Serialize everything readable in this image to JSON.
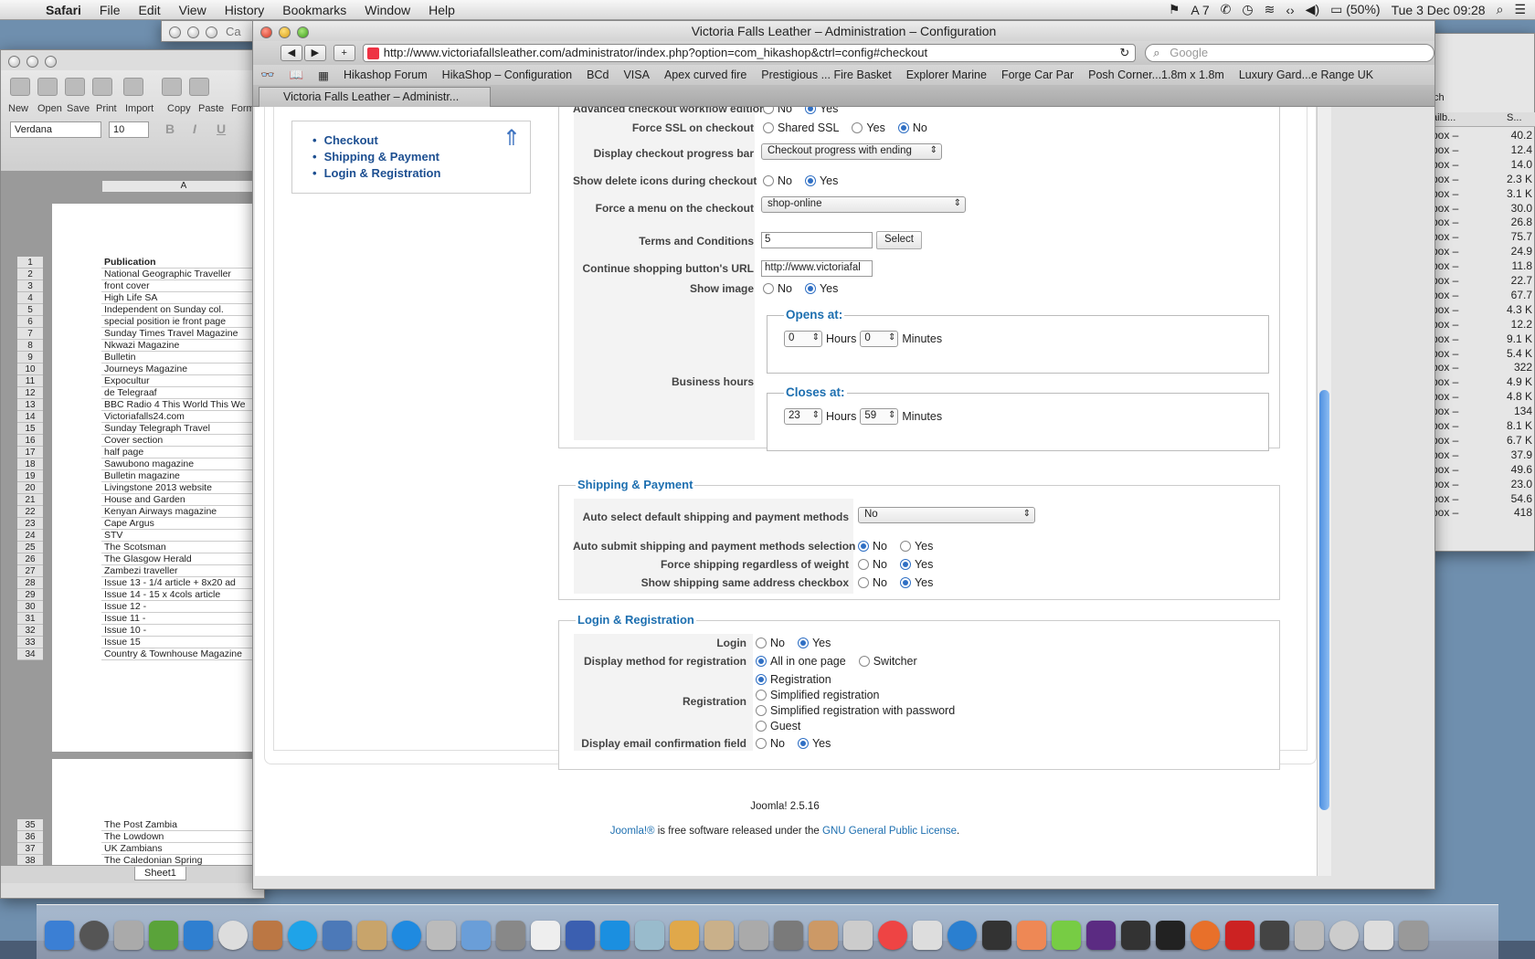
{
  "menubar": {
    "app": "Safari",
    "items": [
      "File",
      "Edit",
      "View",
      "History",
      "Bookmarks",
      "Window",
      "Help"
    ],
    "status": {
      "adobe": "7",
      "battery": "(50%)",
      "clock": "Tue 3 Dec  09:28"
    }
  },
  "spreadsheet": {
    "title": "Ca",
    "toolbar": [
      "New",
      "Open",
      "Save",
      "Print",
      "Import",
      "Copy",
      "Paste",
      "Form"
    ],
    "font": "Verdana",
    "size": "10",
    "column": "A",
    "rows_page1": [
      "Publication",
      "National Geographic Traveller",
      "  front cover",
      "High Life SA",
      "Independent on Sunday col.",
      "   special position ie front page",
      "Sunday Times Travel Magazine",
      "Nkwazi Magazine",
      "Bulletin",
      "Journeys Magazine",
      "Expocultur",
      "de Telegraaf",
      "BBC Radio 4 This World This We",
      "Victoriafalls24.com",
      "Sunday Telegraph Travel",
      "   Cover section",
      "   half page",
      "Sawubono magazine",
      "Bulletin magazine",
      "Livingstone 2013 website",
      "House and Garden",
      "Kenyan Airways magazine",
      "Cape Argus",
      "STV",
      "The Scotsman",
      "The Glasgow Herald",
      "Zambezi traveller",
      "Issue 13 - 1/4 article + 8x20 ad",
      "Issue 14 -  15 x 4cols article",
      "Issue 12 -",
      "Issue 11 -",
      "Issue 10 -",
      "Issue 15",
      "Country & Townhouse Magazine"
    ],
    "row_numbers_page1": [
      "1",
      "2",
      "3",
      "4",
      "5",
      "6",
      "7",
      "8",
      "9",
      "10",
      "11",
      "12",
      "13",
      "14",
      "15",
      "16",
      "17",
      "18",
      "19",
      "20",
      "21",
      "22",
      "23",
      "24",
      "25",
      "26",
      "27",
      "28",
      "29",
      "30",
      "31",
      "32",
      "33",
      "34"
    ],
    "rows_page2": [
      "The Post Zambia",
      "The Lowdown",
      "UK Zambians",
      "The Caledonian Spring"
    ],
    "row_numbers_page2": [
      "35",
      "36",
      "37",
      "38"
    ],
    "sheet_tab": "Sheet1"
  },
  "mail": {
    "header_col1": "ailb...",
    "header_col2": "S...",
    "search_fragment": "ch",
    "rows": [
      {
        "name": "box –",
        "size": "40.2"
      },
      {
        "name": "box –",
        "size": "12.4"
      },
      {
        "name": "box –",
        "size": "14.0"
      },
      {
        "name": "box –",
        "size": "2.3 K"
      },
      {
        "name": "box –",
        "size": "3.1 K"
      },
      {
        "name": "box –",
        "size": "30.0"
      },
      {
        "name": "box –",
        "size": "26.8"
      },
      {
        "name": "box –",
        "size": "75.7"
      },
      {
        "name": "box –",
        "size": "24.9"
      },
      {
        "name": "box –",
        "size": "11.8"
      },
      {
        "name": "box –",
        "size": "22.7"
      },
      {
        "name": "box –",
        "size": "67.7"
      },
      {
        "name": "box –",
        "size": "4.3 K"
      },
      {
        "name": "box –",
        "size": "12.2"
      },
      {
        "name": "box –",
        "size": "9.1 K"
      },
      {
        "name": "box –",
        "size": "5.4 K"
      },
      {
        "name": "box –",
        "size": "322"
      },
      {
        "name": "box –",
        "size": "4.9 K"
      },
      {
        "name": "box –",
        "size": "4.8 K"
      },
      {
        "name": "box –",
        "size": "134"
      },
      {
        "name": "box –",
        "size": "8.1 K"
      },
      {
        "name": "box –",
        "size": "6.7 K"
      },
      {
        "name": "box –",
        "size": "37.9"
      },
      {
        "name": "box –",
        "size": "49.6"
      },
      {
        "name": "box –",
        "size": "23.0"
      },
      {
        "name": "box –",
        "size": "54.6"
      },
      {
        "name": "box –",
        "size": "418"
      }
    ]
  },
  "safari": {
    "title": "Victoria Falls Leather – Administration – Configuration",
    "url": "http://www.victoriafallsleather.com/administrator/index.php?option=com_hikashop&ctrl=config#checkout",
    "search_placeholder": "Google",
    "bookmarks": [
      "Hikashop Forum",
      "HikaShop – Configuration",
      "BCd",
      "VISA",
      "Apex curved fire",
      "Prestigious ... Fire Basket",
      "Explorer Marine",
      "Forge Car Par",
      "Posh Corner...1.8m x 1.8m",
      "Luxury Gard...e Range UK"
    ],
    "tab": "Victoria Falls Leather – Administr..."
  },
  "toc": [
    "Checkout",
    "Shipping & Payment",
    "Login & Registration"
  ],
  "checkout": {
    "partial_label": "Advanced checkout workflow edition",
    "partial_opts": [
      "No",
      "Yes"
    ],
    "force_ssl": {
      "label": "Force SSL on checkout",
      "opts": [
        "Shared SSL",
        "Yes",
        "No"
      ]
    },
    "progress": {
      "label": "Display checkout progress bar",
      "value": "Checkout progress with ending"
    },
    "delete_icons": {
      "label": "Show delete icons during checkout",
      "opts": [
        "No",
        "Yes"
      ]
    },
    "force_menu": {
      "label": "Force a menu on the checkout",
      "value": "shop-online"
    },
    "terms": {
      "label": "Terms and Conditions",
      "value": "5",
      "button": "Select"
    },
    "continue_url": {
      "label": "Continue shopping button's URL",
      "value": "http://www.victoriafal"
    },
    "show_image": {
      "label": "Show image",
      "opts": [
        "No",
        "Yes"
      ]
    },
    "business": {
      "label": "Business hours",
      "opens": "Opens at:",
      "closes": "Closes at:",
      "open_h": "0",
      "open_m": "0",
      "close_h": "23",
      "close_m": "59",
      "hours": "Hours",
      "minutes": "Minutes"
    }
  },
  "shipping": {
    "legend": "Shipping & Payment",
    "auto_select": {
      "label": "Auto select default shipping and payment methods",
      "value": "No"
    },
    "auto_submit": {
      "label": "Auto submit shipping and payment methods selection",
      "opts": [
        "No",
        "Yes"
      ]
    },
    "force_shipping": {
      "label": "Force shipping regardless of weight",
      "opts": [
        "No",
        "Yes"
      ]
    },
    "same_address": {
      "label": "Show shipping same address checkbox",
      "opts": [
        "No",
        "Yes"
      ]
    }
  },
  "login": {
    "legend": "Login & Registration",
    "login": {
      "label": "Login",
      "opts": [
        "No",
        "Yes"
      ]
    },
    "display_method": {
      "label": "Display method for registration",
      "opts": [
        "All in one page",
        "Switcher"
      ]
    },
    "registration": {
      "label": "Registration",
      "opts": [
        "Registration",
        "Simplified registration",
        "Simplified registration with password",
        "Guest"
      ]
    },
    "email_confirm": {
      "label": "Display email confirmation field",
      "opts": [
        "No",
        "Yes"
      ]
    }
  },
  "footer": {
    "version": "Joomla! 2.5.16",
    "link1": "Joomla!®",
    "text": " is free software released under the ",
    "link2": "GNU General Public License",
    "end": "."
  }
}
